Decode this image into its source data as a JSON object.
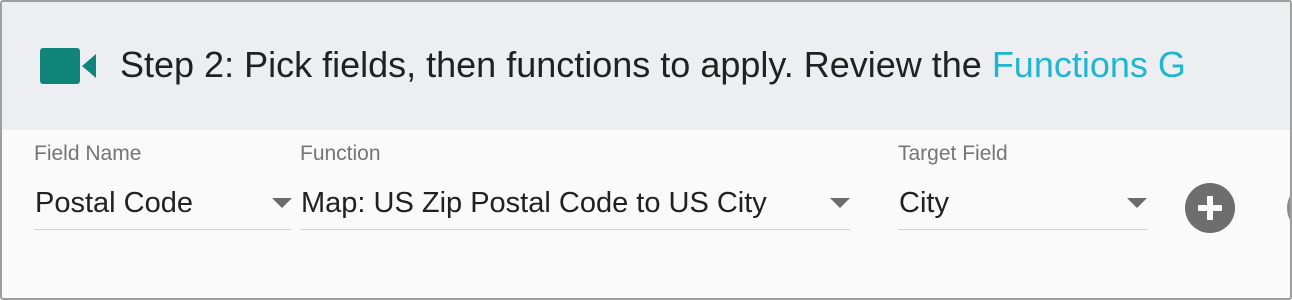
{
  "header": {
    "icon": "video-camera-icon",
    "title_text": "Step 2: Pick fields, then functions to apply. Review the ",
    "title_link": "Functions G",
    "accent_color": "#1fb7cf",
    "icon_color": "#11847a"
  },
  "fields": {
    "field_name": {
      "label": "Field Name",
      "value": "Postal Code"
    },
    "function": {
      "label": "Function",
      "value": "Map: US Zip Postal Code to US City"
    },
    "target_field": {
      "label": "Target Field",
      "value": "City"
    }
  },
  "actions": {
    "add_icon": "plus-circle-icon",
    "second_icon": "circle-outline-icon"
  }
}
